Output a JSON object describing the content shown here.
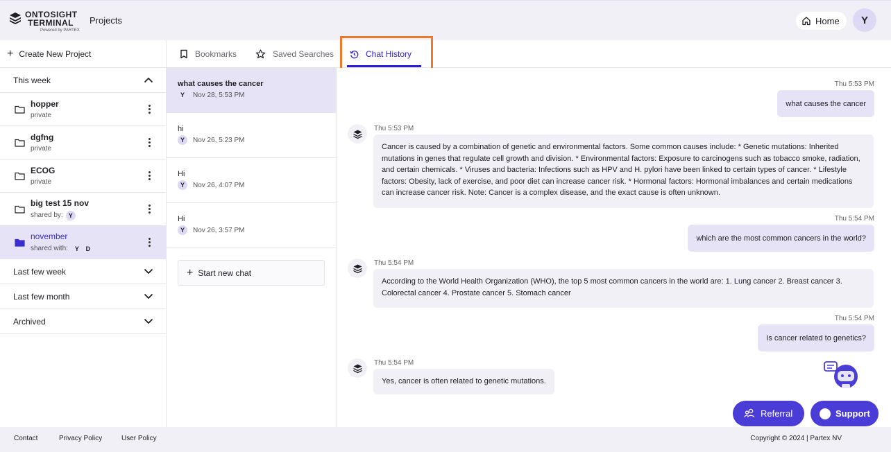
{
  "header": {
    "logo_word_1": "ONTOSIGHT",
    "logo_word_2": "TERMINAL",
    "logo_sub": "Powered by PARTEX",
    "title": "Projects",
    "home_label": "Home",
    "avatar_initial": "Y"
  },
  "sidebar": {
    "create_label": "Create New Project",
    "this_week_label": "This week",
    "projects": [
      {
        "name": "hopper",
        "sub": "private"
      },
      {
        "name": "dgfng",
        "sub": "private"
      },
      {
        "name": "ECOG",
        "sub": "private"
      },
      {
        "name": "big test 15 nov",
        "sub": "shared by:",
        "avatars": [
          "Y"
        ]
      },
      {
        "name": "november",
        "sub": "shared with:",
        "avatars": [
          "Y",
          "D"
        ]
      }
    ],
    "sections": [
      {
        "label": "Last few week"
      },
      {
        "label": "Last few month"
      },
      {
        "label": "Archived"
      }
    ]
  },
  "tabs": [
    {
      "label": "Bookmarks"
    },
    {
      "label": "Saved Searches"
    },
    {
      "label": "Chat History"
    }
  ],
  "chats": [
    {
      "title": "what causes the cancer",
      "avatar": "Y",
      "date": "Nov 28, 5:53 PM"
    },
    {
      "title": "hi",
      "avatar": "Y",
      "date": "Nov 26, 5:23 PM"
    },
    {
      "title": "Hi",
      "avatar": "Y",
      "date": "Nov 26, 4:07 PM"
    },
    {
      "title": "Hi",
      "avatar": "Y",
      "date": "Nov 26, 3:57 PM"
    }
  ],
  "new_chat_label": "Start new chat",
  "messages": {
    "m1": {
      "time": "Thu 5:53 PM",
      "text": "what causes the cancer"
    },
    "m2": {
      "time": "Thu 5:53 PM",
      "text": "Cancer is caused by a combination of genetic and environmental factors. Some common causes include: * Genetic mutations: Inherited mutations in genes that regulate cell growth and division. * Environmental factors: Exposure to carcinogens such as tobacco smoke, radiation, and certain chemicals. * Viruses and bacteria: Infections such as HPV and H. pylori have been linked to certain types of cancer. * Lifestyle factors: Obesity, lack of exercise, and poor diet can increase cancer risk. * Hormonal factors: Hormonal imbalances and certain medications can increase cancer risk. Note: Cancer is a complex disease, and the exact cause is often unknown."
    },
    "m3": {
      "time": "Thu 5:54 PM",
      "text": "which are the most common cancers in the world?"
    },
    "m4": {
      "time": "Thu 5:54 PM",
      "text": "According to the World Health Organization (WHO), the top 5 most common cancers in the world are: 1. Lung cancer 2. Breast cancer 3. Colorectal cancer 4. Prostate cancer 5. Stomach cancer"
    },
    "m5": {
      "time": "Thu 5:54 PM",
      "text": "Is cancer related to genetics?"
    },
    "m6": {
      "time": "Thu 5:54 PM",
      "text": "Yes, cancer is often related to genetic mutations."
    }
  },
  "buttons": {
    "referral": "Referral",
    "support": "Support"
  },
  "footer": {
    "contact": "Contact",
    "privacy": "Privacy Policy",
    "user_policy": "User Policy",
    "copyright": "Copyright © 2024 | Partex NV"
  },
  "colors": {
    "accent": "#2c1fd1",
    "button": "#4a3cd6",
    "selected_bg": "#e6e3f7",
    "highlight_border": "#f07a2c"
  }
}
